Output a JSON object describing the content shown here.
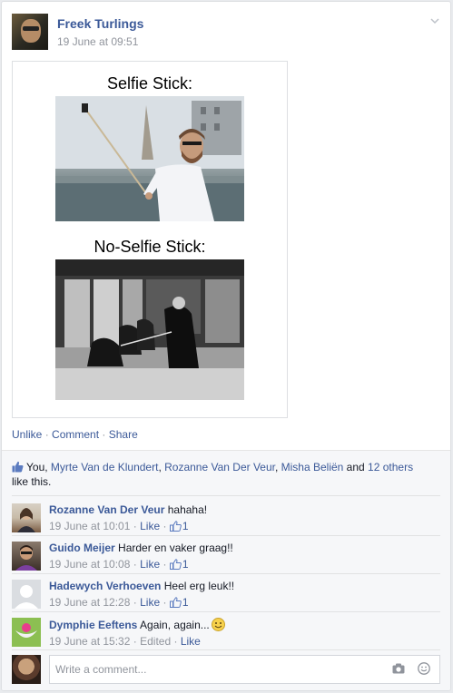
{
  "post": {
    "author": "Freek Turlings",
    "time": "19 June at 09:51",
    "image_caption_top": "Selfie Stick:",
    "image_caption_bottom": "No-Selfie Stick:"
  },
  "actions": {
    "unlike": "Unlike",
    "comment": "Comment",
    "share": "Share",
    "separator": "·"
  },
  "likes": {
    "prefix": "You, ",
    "names": [
      "Myrte Van de Klundert",
      "Rozanne Van Der Veur",
      "Misha Beliën"
    ],
    "and": " and ",
    "others": "12 others",
    "suffix": "like this.",
    "comma": ", "
  },
  "comments": [
    {
      "name": "Rozanne Van Der Veur",
      "text": "hahaha!",
      "time": "19 June at 10:01",
      "like_label": "Like",
      "like_count": "1"
    },
    {
      "name": "Guido Meijer",
      "text": "Harder en vaker graag!!",
      "time": "19 June at 10:08",
      "like_label": "Like",
      "like_count": "1"
    },
    {
      "name": "Hadewych Verhoeven",
      "text": "Heel erg leuk!!",
      "time": "19 June at 12:28",
      "like_label": "Like",
      "like_count": "1"
    },
    {
      "name": "Dymphie Eeftens",
      "text": "Again, again...",
      "time": "19 June at 15:32",
      "edited": "Edited",
      "like_label": "Like"
    }
  ],
  "composer": {
    "placeholder": "Write a comment..."
  },
  "icons": {
    "chevron": "chevron-down-icon",
    "thumb": "thumbs-up-icon",
    "camera": "camera-icon",
    "emoji": "emoji-icon"
  },
  "colors": {
    "link": "#3b5998",
    "meta": "#90949c",
    "feedback_bg": "#f6f7f9"
  }
}
